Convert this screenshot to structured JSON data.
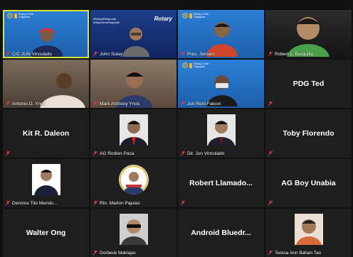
{
  "participants": [
    {
      "name": "C/C JUN Vinculado",
      "row": 0,
      "col": 0,
      "active": true
    },
    {
      "name": "John Sulay",
      "row": 0,
      "col": 1
    },
    {
      "name": "Pres. Jensen",
      "row": 0,
      "col": 2
    },
    {
      "name": "Robert L. Barquilla",
      "row": 0,
      "col": 3
    },
    {
      "name": "Antonio D. Ynoc",
      "row": 1,
      "col": 0
    },
    {
      "name": "Mark Anthony Ynoc",
      "row": 1,
      "col": 1
    },
    {
      "name": "Jun Rom Falcon",
      "row": 1,
      "col": 2
    },
    {
      "name": "PDG Ted",
      "row": 1,
      "col": 3
    },
    {
      "name": "Kit R. Daleon",
      "row": 2,
      "col": 0
    },
    {
      "name": "AG Rodien Paca",
      "row": 2,
      "col": 1
    },
    {
      "name": "Dir. Jun Vinculado",
      "row": 2,
      "col": 2
    },
    {
      "name": "Toby Florendo",
      "row": 2,
      "col": 3
    },
    {
      "name": "Dennice Tito Mendo...",
      "row": 3,
      "col": 0
    },
    {
      "name": "Rtn. Marlon Pajulas",
      "row": 3,
      "col": 1
    },
    {
      "name": "Robert  Llamado...",
      "row": 3,
      "col": 2
    },
    {
      "name": "AG Boy Unabia",
      "row": 3,
      "col": 3
    },
    {
      "name": "Walter Ong",
      "row": 4,
      "col": 0
    },
    {
      "name": "Dorbeck Makiapo",
      "row": 4,
      "col": 1
    },
    {
      "name": "Android Bluedr...",
      "row": 4,
      "col": 2
    },
    {
      "name": "Teresa Ann Bahan Tan",
      "row": 4,
      "col": 3
    }
  ],
  "rotary": {
    "logo_text": "Rotary",
    "header_line1": "Rotary Club",
    "header_line2": "Cagayan",
    "banner_line1": "#RotaryResponds",
    "banner_line2": "#StayHomeStaySafe"
  },
  "colors": {
    "background": "#111111",
    "tile": "#1e1e1e",
    "active_border": "#d8e635",
    "mic_muted": "#e23b3b"
  }
}
